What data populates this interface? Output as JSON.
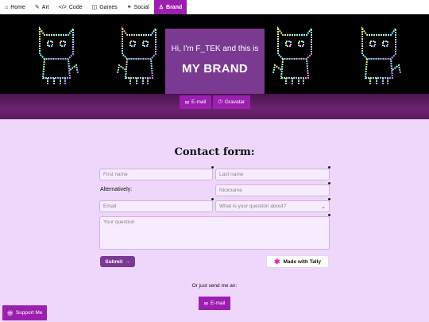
{
  "nav": {
    "items": [
      {
        "icon": "⌂",
        "label": "Home"
      },
      {
        "icon": "✎",
        "label": "Art"
      },
      {
        "icon": "</>",
        "label": "Code"
      },
      {
        "icon": "◫",
        "label": "Games"
      },
      {
        "icon": "⚭",
        "label": "Social"
      },
      {
        "icon": "♙",
        "label": "Brand"
      }
    ],
    "active": "Brand"
  },
  "hero": {
    "greeting": "Hi, I'm F_TEK and this is",
    "title": "MY BRAND"
  },
  "links": {
    "email_label": "E-mail",
    "gravatar_label": "Gravatar"
  },
  "form": {
    "title": "Contact form:",
    "first_name_placeholder": "First name",
    "last_name_placeholder": "Last name",
    "alternatively_label": "Alternatively:",
    "nickname_placeholder": "Nickname",
    "email_placeholder": "Email",
    "question_select_placeholder": "What is your question about?",
    "question_placeholder": "Your question",
    "submit_label": "Submit",
    "submit_icon": "→",
    "tally_label": "Made with Tally"
  },
  "footer": {
    "send_note": "Or just send me an:",
    "email_label": "E-mail",
    "support_label": "Support Me"
  },
  "colors": {
    "accent": "#9c1fb0",
    "hero_bg": "#7a3a92",
    "page_bg": "#eed7fb"
  }
}
